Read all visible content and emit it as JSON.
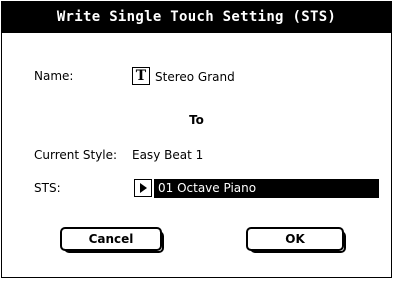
{
  "dialog": {
    "title": "Write Single Touch Setting (STS)",
    "name_label": "Name:",
    "name_icon": "T",
    "name_value": "Stereo Grand",
    "to_label": "To",
    "current_style_label": "Current Style:",
    "current_style_value": "Easy Beat 1",
    "sts_label": "STS:",
    "sts_value": "01 Octave Piano",
    "cancel_label": "Cancel",
    "ok_label": "OK"
  },
  "colors": {
    "titlebar_bg": "#000000",
    "titlebar_text": "#ffffff",
    "selected_field_bg": "#000000"
  }
}
